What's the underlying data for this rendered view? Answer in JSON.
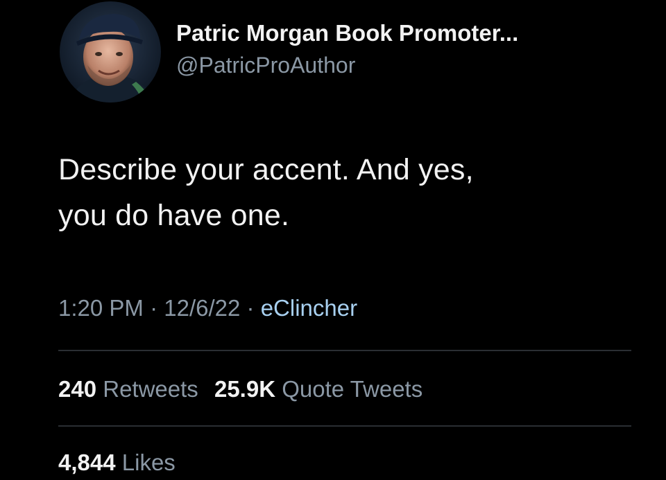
{
  "author": {
    "display_name": "Patric Morgan Book Promoter...",
    "handle": "@PatricProAuthor"
  },
  "tweet": {
    "text_line1": "Describe your accent. And yes,",
    "text_line2": "you do have one."
  },
  "meta": {
    "time": "1:20 PM",
    "separator": "·",
    "date": "12/6/22",
    "source": "eClincher"
  },
  "stats": {
    "retweets_count": "240",
    "retweets_label": "Retweets",
    "quote_count": "25.9K",
    "quote_label": "Quote Tweets",
    "likes_count": "4,844",
    "likes_label": "Likes"
  },
  "colors": {
    "background": "#000000",
    "primary_text": "#f2f2f2",
    "secondary_text": "#8b98a5",
    "link": "#a8d0f0",
    "divider": "#2a2e33"
  }
}
